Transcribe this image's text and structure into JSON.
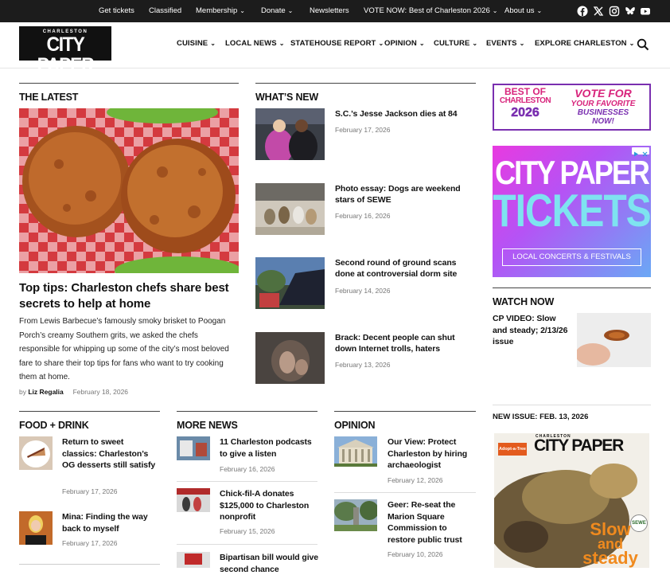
{
  "topbar": {
    "links": [
      "Get tickets",
      "Classified",
      "Membership",
      "Donate",
      "Newsletters",
      "VOTE NOW: Best of Charleston 2026",
      "About us"
    ],
    "social": [
      "facebook-icon",
      "x-icon",
      "instagram-icon",
      "bluesky-icon",
      "youtube-icon"
    ]
  },
  "logo": {
    "small": "CHARLESTON",
    "big": "CITY PAPER"
  },
  "nav": [
    "CUISINE",
    "LOCAL NEWS",
    "STATEHOUSE REPORT",
    "OPINION",
    "CULTURE",
    "EVENTS",
    "EXPLORE CHARLESTON"
  ],
  "latest": {
    "heading": "THE LATEST",
    "headline": "Top tips: Charleston chefs share best secrets to help at home",
    "excerpt": "From Lewis Barbecue’s famously smoky brisket to Poogan Porch’s creamy Southern grits, we asked the chefs responsible for whipping up some of the city’s most beloved fare to share their top tips for fans who want to try cooking them at home.",
    "by": "by",
    "author": "Liz Regalia",
    "date": "February 18, 2026"
  },
  "whats_new": {
    "heading": "WHAT’S NEW",
    "items": [
      {
        "title": "S.C.’s Jesse Jackson dies at 84",
        "date": "February 17, 2026"
      },
      {
        "title": "Photo essay: Dogs are weekend stars of SEWE",
        "date": "February 16, 2026"
      },
      {
        "title": "Second round of ground scans done at controversial dorm site",
        "date": "February 14, 2026"
      },
      {
        "title": "Brack: Decent people can shut down Internet trolls, haters",
        "date": "February 13, 2026"
      }
    ]
  },
  "ads": {
    "best_of_line1": "BEST OF",
    "best_of_line2": "CHARLESTON",
    "best_of_year": "2026",
    "vote_line1": "VOTE FOR",
    "vote_line2": "YOUR FAVORITE",
    "vote_line3": "BUSINESSES",
    "vote_line4": "NOW!",
    "tickets_line1": "CITY PAPER",
    "tickets_line2": "TICKETS",
    "tickets_sub": "LOCAL CONCERTS & FESTIVALS"
  },
  "watch_now": {
    "heading": "WATCH NOW",
    "title": "CP VIDEO: Slow and steady; 2/13/26 issue"
  },
  "new_issue": {
    "heading": "NEW ISSUE: FEB. 13, 2026",
    "cover_small": "CHARLESTON",
    "cover_big": "CITY PAPER",
    "cover_tag": "Adopt-a-Tree",
    "cover_line1": "Slow",
    "cover_line2": "and",
    "cover_line3": "steady",
    "cover_badge": "SEWE"
  },
  "food": {
    "heading": "FOOD + DRINK",
    "items": [
      {
        "title": "Return to sweet classics: Charleston’s OG desserts still satisfy",
        "date": "February 17, 2026"
      },
      {
        "title": "Mina: Finding the way back to myself",
        "date": "February 17, 2026"
      }
    ]
  },
  "more_news": {
    "heading": "MORE NEWS",
    "items": [
      {
        "title": "11 Charleston podcasts to give a listen",
        "date": "February 16, 2026"
      },
      {
        "title": "Chick-fil-A donates $125,000 to Charleston nonprofit",
        "date": "February 15, 2026"
      },
      {
        "title": "Bipartisan bill would give second chance",
        "date": ""
      }
    ]
  },
  "opinion": {
    "heading": "OPINION",
    "items": [
      {
        "title": "Our View: Protect Charleston by hiring archaeologist",
        "date": "February 12, 2026"
      },
      {
        "title": "Geer: Re-seat the Marion Square Commission to restore public trust",
        "date": "February 10, 2026"
      }
    ]
  },
  "colors": {
    "topbar": "#1c1c1c",
    "accent_purple": "#7a2fb0",
    "accent_pink": "#e83ae0"
  }
}
